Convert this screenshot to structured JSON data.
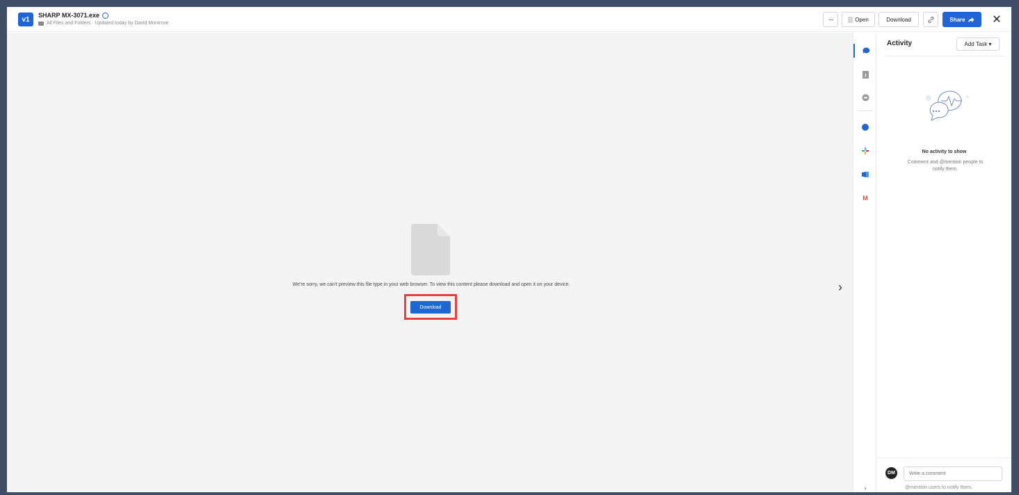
{
  "header": {
    "version": "v1",
    "file_name": "SHARP MX-3071.exe",
    "breadcrumb": "All Files and Folders · Updated today by David Montrose",
    "more_label": "···",
    "open_label": "Open",
    "download_label": "Download",
    "share_label": "Share",
    "close_label": "✕"
  },
  "preview": {
    "message": "We're sorry, we can't preview this file type in your web browser. To view this content please download and open it on your device.",
    "download_label": "Download",
    "next_label": "›"
  },
  "sidebar_tabs": {
    "icons": [
      "comment-icon",
      "details-icon",
      "versions-icon",
      "app-icon",
      "slack-icon",
      "outlook-icon",
      "gmail-icon"
    ],
    "gmail_label": "M",
    "collapse_label": "›"
  },
  "activity": {
    "title": "Activity",
    "add_task_label": "Add Task ▾",
    "empty_title": "No activity to show",
    "empty_subtitle": "Comment and @mention people to notify them.",
    "avatar_initials": "DM",
    "comment_placeholder": "Write a comment",
    "comment_hint": "@mention users to notify them."
  },
  "colors": {
    "accent": "#1f66d4",
    "highlight": "#e8413d",
    "backdrop": "#3f4e66"
  }
}
